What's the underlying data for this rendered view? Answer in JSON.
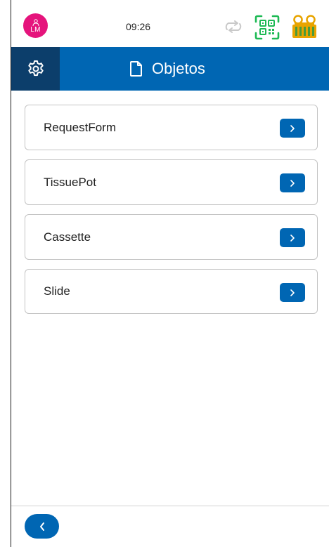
{
  "status_bar": {
    "avatar_initials": "LM",
    "time": "09:26",
    "icons": [
      "person-icon",
      "sync-icon",
      "qr-code-icon",
      "label-printer-icon"
    ]
  },
  "header": {
    "settings_icon": "gear-icon",
    "title_icon": "document-icon",
    "title": "Objetos"
  },
  "objects": [
    {
      "label": "RequestForm"
    },
    {
      "label": "TissuePot"
    },
    {
      "label": "Cassette"
    },
    {
      "label": "Slide"
    }
  ],
  "footer": {
    "back_icon": "chevron-left-icon"
  },
  "colors": {
    "primary": "#0066b3",
    "settings_bg": "#0c3e6b",
    "avatar": "#e5147c",
    "qr_icon": "#1db954",
    "printer_icon": "#e8a400"
  }
}
